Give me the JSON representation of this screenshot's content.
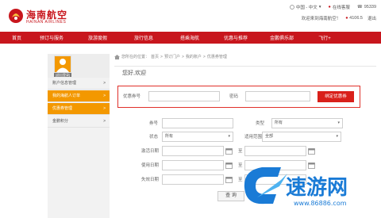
{
  "brand": {
    "name_cn": "海南航空",
    "name_en": "HAINAN AIRLINES",
    "color": "#c8161d"
  },
  "header": {
    "region": "中国 - 中文",
    "links": [
      "在线客服",
      "95339"
    ],
    "welcome": "欢迎来到海南航空！",
    "points": "4106.5",
    "logout": "退出"
  },
  "nav": [
    "首页",
    "预订与服务",
    "旅游度假",
    "旅行信息",
    "搭乘海航",
    "优惠与推荐",
    "金鹏俱乐部",
    "飞行+"
  ],
  "sidebar": {
    "avatar_label": "[退出登录]",
    "items": [
      "账户信息管理",
      "我的海航人订单",
      "优惠券管理",
      "金鹏积分"
    ]
  },
  "breadcrumb": [
    "您所在的位置：",
    "首页",
    "预订门户",
    "我的账户",
    "优惠券管理"
  ],
  "hello": "您好,欢迎",
  "coupon_form": {
    "code_label": "优惠券号",
    "code_value": "",
    "password_label": "密码",
    "password_value": "",
    "bind_button": "绑定优惠券"
  },
  "filters": {
    "fields": [
      {
        "label": "券号",
        "value": ""
      },
      {
        "label": "类型",
        "value": "所有"
      },
      {
        "label": "状态",
        "value": "所有"
      },
      {
        "label": "适用范围",
        "value": "全部"
      },
      {
        "label": "激活日期",
        "value": ""
      },
      {
        "label": "使用日期",
        "value": ""
      },
      {
        "label": "失效日期",
        "value": ""
      }
    ],
    "to_label": "至",
    "query_button": "查 询"
  },
  "watermark": {
    "text": "速游网",
    "url": "www.86886.com",
    "color": "#1a7bd6"
  }
}
